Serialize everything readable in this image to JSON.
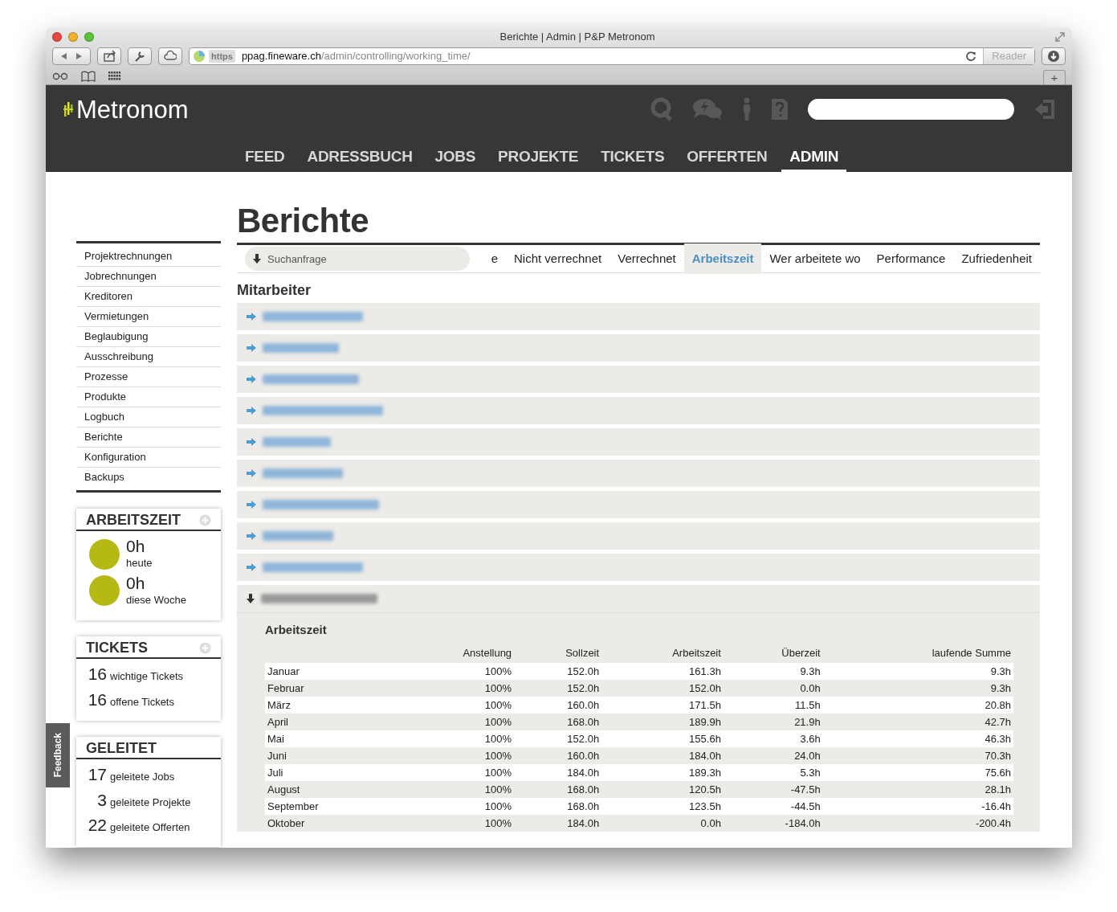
{
  "browser": {
    "title": "Berichte | Admin | P&P Metronom",
    "url_scheme": "https",
    "url_host": "ppag.fineware.ch",
    "url_path": "/admin/controlling/working_time/",
    "reader_button": "Reader",
    "new_tab_button": "+"
  },
  "app": {
    "logo": "Metronom",
    "nav": [
      {
        "label": "FEED",
        "selected": false
      },
      {
        "label": "ADRESSBUCH",
        "selected": false
      },
      {
        "label": "JOBS",
        "selected": false
      },
      {
        "label": "PROJEKTE",
        "selected": false
      },
      {
        "label": "TICKETS",
        "selected": false
      },
      {
        "label": "OFFERTEN",
        "selected": false
      },
      {
        "label": "ADMIN",
        "selected": true
      }
    ]
  },
  "sidebar": {
    "menu": [
      "Projektrechnungen",
      "Jobrechnungen",
      "Kreditoren",
      "Vermietungen",
      "Beglaubigung",
      "Ausschreibung",
      "Prozesse",
      "Produkte",
      "Logbuch",
      "Berichte",
      "Konfiguration",
      "Backups"
    ],
    "widgets": [
      {
        "kind": "circles",
        "title": "ARBEITSZEIT",
        "add_button": true,
        "items": [
          {
            "value": "0h",
            "label": "heute"
          },
          {
            "value": "0h",
            "label": "diese Woche"
          }
        ]
      },
      {
        "kind": "counts",
        "title": "TICKETS",
        "add_button": true,
        "items": [
          {
            "value": "16",
            "label": "wichtige Tickets"
          },
          {
            "value": "16",
            "label": "offene Tickets"
          }
        ]
      },
      {
        "kind": "counts",
        "title": "GELEITET",
        "add_button": false,
        "items": [
          {
            "value": "17",
            "label": "geleitete Jobs"
          },
          {
            "value": "3",
            "label": "geleitete Projekte"
          },
          {
            "value": "22",
            "label": "geleitete Offerten"
          }
        ]
      }
    ]
  },
  "feedback_tab": "Feedback",
  "page": {
    "title": "Berichte",
    "search": {
      "placeholder": "Suchanfrage"
    },
    "tabs": [
      {
        "label": "e",
        "selected": false
      },
      {
        "label": "Nicht verrechnet",
        "selected": false
      },
      {
        "label": "Verrechnet",
        "selected": false
      },
      {
        "label": "Arbeitszeit",
        "selected": true
      },
      {
        "label": "Wer arbeitete wo",
        "selected": false
      },
      {
        "label": "Performance",
        "selected": false
      },
      {
        "label": "Zufriedenheit",
        "selected": false
      }
    ],
    "section_title": "Mitarbeiter",
    "employees": [
      {
        "expanded": false
      },
      {
        "expanded": false
      },
      {
        "expanded": false
      },
      {
        "expanded": false
      },
      {
        "expanded": false
      },
      {
        "expanded": false
      },
      {
        "expanded": false
      },
      {
        "expanded": false
      },
      {
        "expanded": false
      },
      {
        "expanded": true
      }
    ],
    "detail": {
      "title": "Arbeitszeit",
      "columns": [
        "",
        "Anstellung",
        "Sollzeit",
        "Arbeitszeit",
        "Überzeit",
        "laufende Summe"
      ],
      "rows": [
        [
          "Januar",
          "100%",
          "152.0h",
          "161.3h",
          "9.3h",
          "9.3h"
        ],
        [
          "Februar",
          "100%",
          "152.0h",
          "152.0h",
          "0.0h",
          "9.3h"
        ],
        [
          "März",
          "100%",
          "160.0h",
          "171.5h",
          "11.5h",
          "20.8h"
        ],
        [
          "April",
          "100%",
          "168.0h",
          "189.9h",
          "21.9h",
          "42.7h"
        ],
        [
          "Mai",
          "100%",
          "152.0h",
          "155.6h",
          "3.6h",
          "46.3h"
        ],
        [
          "Juni",
          "100%",
          "160.0h",
          "184.0h",
          "24.0h",
          "70.3h"
        ],
        [
          "Juli",
          "100%",
          "184.0h",
          "189.3h",
          "5.3h",
          "75.6h"
        ],
        [
          "August",
          "100%",
          "168.0h",
          "120.5h",
          "-47.5h",
          "28.1h"
        ],
        [
          "September",
          "100%",
          "168.0h",
          "123.5h",
          "-44.5h",
          "-16.4h"
        ],
        [
          "Oktober",
          "100%",
          "184.0h",
          "0.0h",
          "-184.0h",
          "-200.4h"
        ]
      ]
    }
  }
}
